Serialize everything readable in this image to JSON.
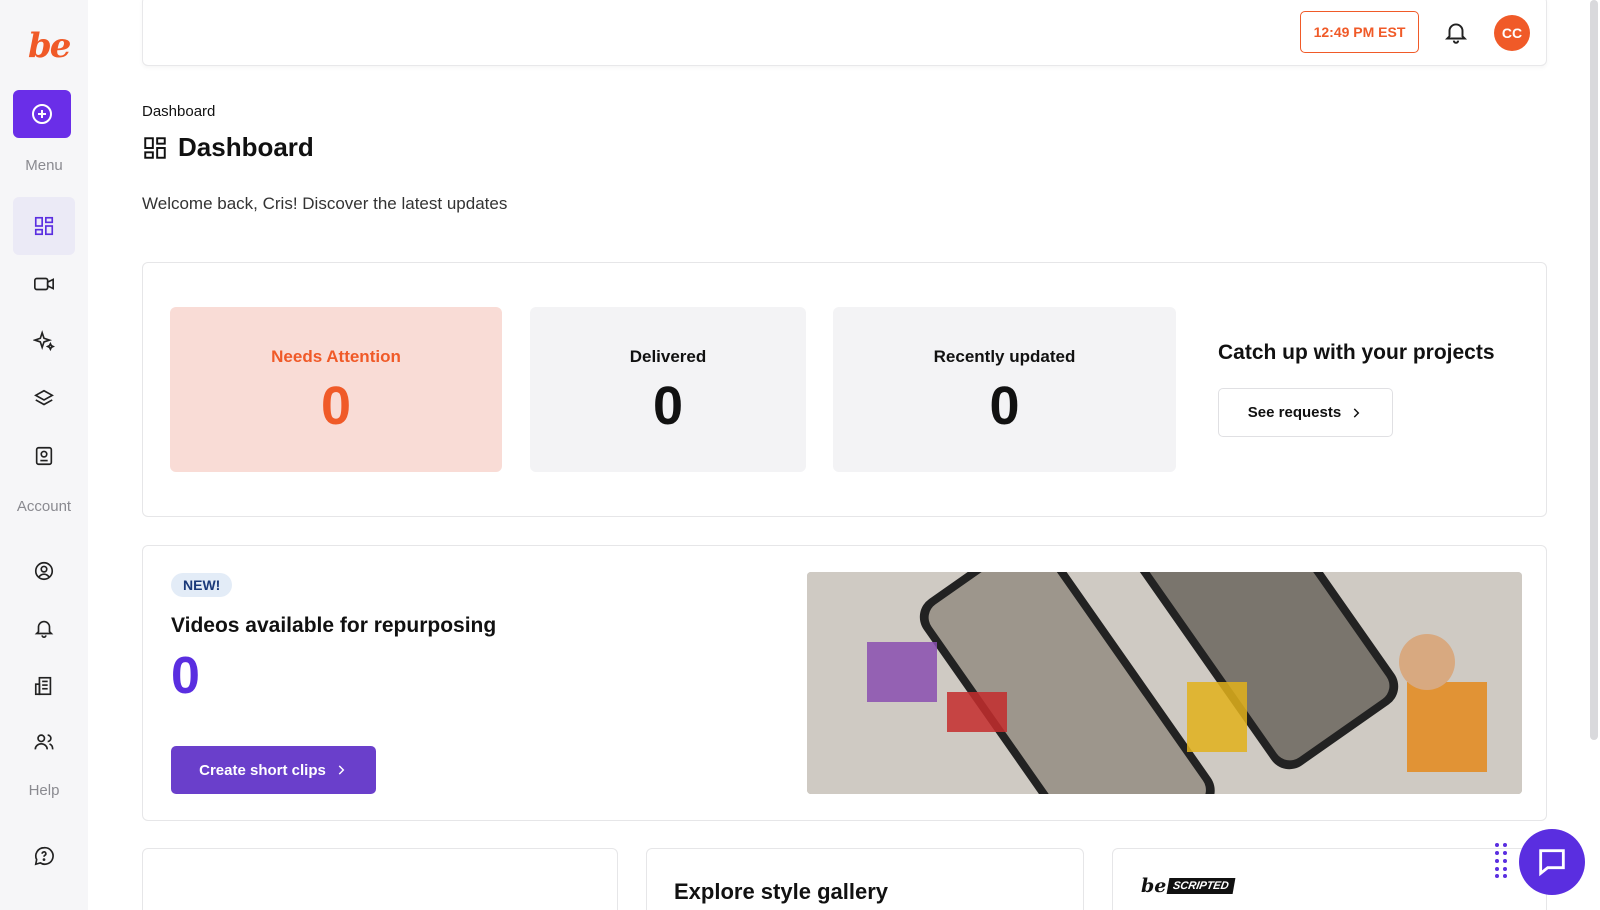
{
  "sidebar": {
    "logo_text": "be",
    "sections": {
      "menu": "Menu",
      "account": "Account",
      "help": "Help"
    },
    "menu_items": [
      {
        "icon": "dashboard-icon",
        "active": true
      },
      {
        "icon": "video-camera-icon"
      },
      {
        "icon": "sparkles-icon"
      },
      {
        "icon": "layers-icon"
      },
      {
        "icon": "brand-kit-icon"
      }
    ],
    "account_items": [
      {
        "icon": "user-circle-icon"
      },
      {
        "icon": "bell-icon"
      },
      {
        "icon": "building-icon"
      },
      {
        "icon": "users-icon"
      }
    ],
    "help_items": [
      {
        "icon": "help-chat-icon"
      }
    ]
  },
  "header": {
    "time": "12:49 PM EST",
    "avatar_initials": "CC"
  },
  "page": {
    "breadcrumb": "Dashboard",
    "title": "Dashboard",
    "welcome": "Welcome back, Cris! Discover the latest updates"
  },
  "stats": {
    "needs_attention": {
      "label": "Needs Attention",
      "value": "0"
    },
    "delivered": {
      "label": "Delivered",
      "value": "0"
    },
    "recently_updated": {
      "label": "Recently updated",
      "value": "0"
    },
    "catch_up_title": "Catch up with your projects",
    "see_requests_label": "See requests"
  },
  "repurpose": {
    "badge": "NEW!",
    "title": "Videos available for repurposing",
    "value": "0",
    "button_label": "Create short clips"
  },
  "bottom": {
    "explore_title": "Explore style gallery",
    "scripted_be": "be",
    "scripted_label": "SCRIPTED"
  },
  "colors": {
    "brand_orange": "#f05a28",
    "brand_purple": "#6a2ee8",
    "attention_bg": "#f9dcd6"
  }
}
